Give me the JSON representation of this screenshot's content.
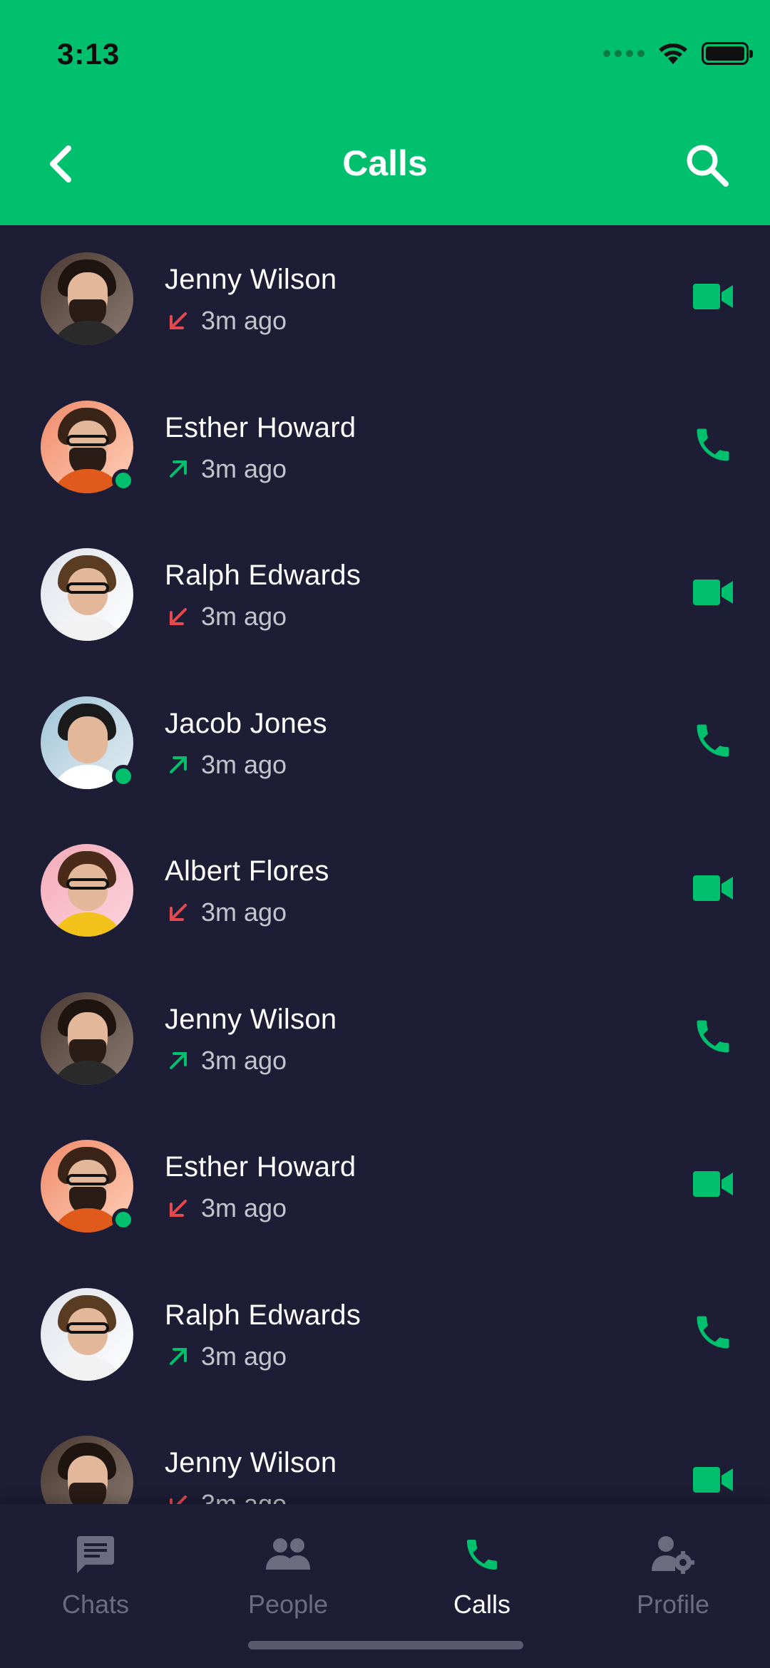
{
  "status_bar": {
    "time": "3:13"
  },
  "header": {
    "title": "Calls"
  },
  "colors": {
    "accent": "#00bf6d",
    "background": "#1d1d35",
    "missed": "#e5484d",
    "outgoing": "#00bf6d"
  },
  "calls": [
    {
      "name": "Jenny Wilson",
      "time": "3m ago",
      "direction": "incoming-missed",
      "call_type": "video",
      "online": false
    },
    {
      "name": "Esther Howard",
      "time": "3m ago",
      "direction": "outgoing",
      "call_type": "voice",
      "online": true
    },
    {
      "name": "Ralph Edwards",
      "time": "3m ago",
      "direction": "incoming-missed",
      "call_type": "video",
      "online": false
    },
    {
      "name": "Jacob Jones",
      "time": "3m ago",
      "direction": "outgoing",
      "call_type": "voice",
      "online": true
    },
    {
      "name": "Albert Flores",
      "time": "3m ago",
      "direction": "incoming-missed",
      "call_type": "video",
      "online": false
    },
    {
      "name": "Jenny Wilson",
      "time": "3m ago",
      "direction": "outgoing",
      "call_type": "voice",
      "online": false
    },
    {
      "name": "Esther Howard",
      "time": "3m ago",
      "direction": "incoming-missed",
      "call_type": "video",
      "online": true
    },
    {
      "name": "Ralph Edwards",
      "time": "3m ago",
      "direction": "outgoing",
      "call_type": "voice",
      "online": false
    },
    {
      "name": "Jenny Wilson",
      "time": "3m ago",
      "direction": "incoming-missed",
      "call_type": "video",
      "online": false
    }
  ],
  "tabs": [
    {
      "label": "Chats",
      "icon": "chat-icon",
      "active": false
    },
    {
      "label": "People",
      "icon": "people-icon",
      "active": false
    },
    {
      "label": "Calls",
      "icon": "phone-icon",
      "active": true
    },
    {
      "label": "Profile",
      "icon": "profile-settings-icon",
      "active": false
    }
  ]
}
